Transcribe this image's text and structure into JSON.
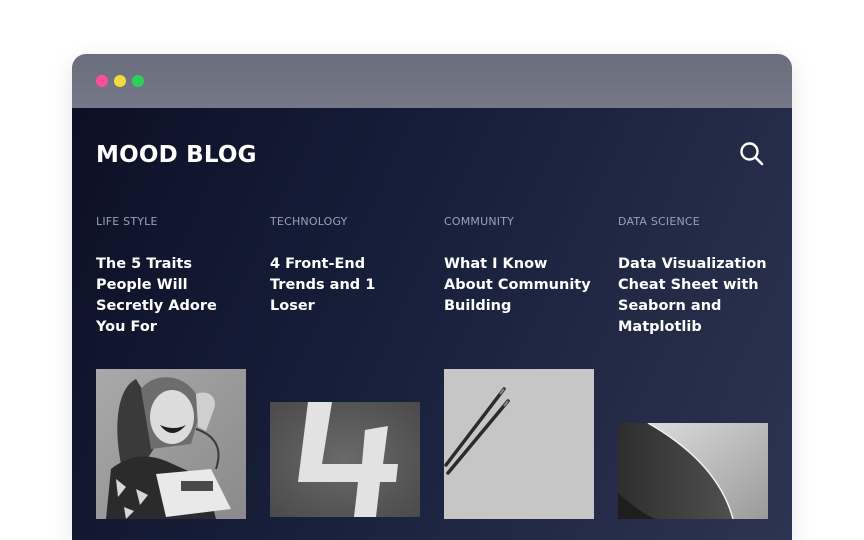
{
  "window": {
    "controls": [
      "close",
      "minimize",
      "maximize"
    ]
  },
  "header": {
    "logo": "MOOD BLOG",
    "search_icon": "search-icon"
  },
  "posts": [
    {
      "category": "LIFE STYLE",
      "title": "The 5 Traits People Will Secretly Adore You For",
      "image": "woman-with-telephone-photo"
    },
    {
      "category": "TECHNOLOGY",
      "title": "4 Front-End Trends and 1 Loser",
      "image": "number-four-photo"
    },
    {
      "category": "COMMUNITY",
      "title": "What I Know About Community Building",
      "image": "pencils-photo"
    },
    {
      "category": "DATA SCIENCE",
      "title": "Data Visualization Cheat Sheet with Seaborn and Matplotlib",
      "image": "abstract-curve-photo"
    }
  ],
  "colors": {
    "dot_red": "#ff4d9c",
    "dot_yellow": "#f1db3d",
    "dot_green": "#2bd15a",
    "background_dark": "#0c1026",
    "category_text": "#9aa0b6"
  }
}
